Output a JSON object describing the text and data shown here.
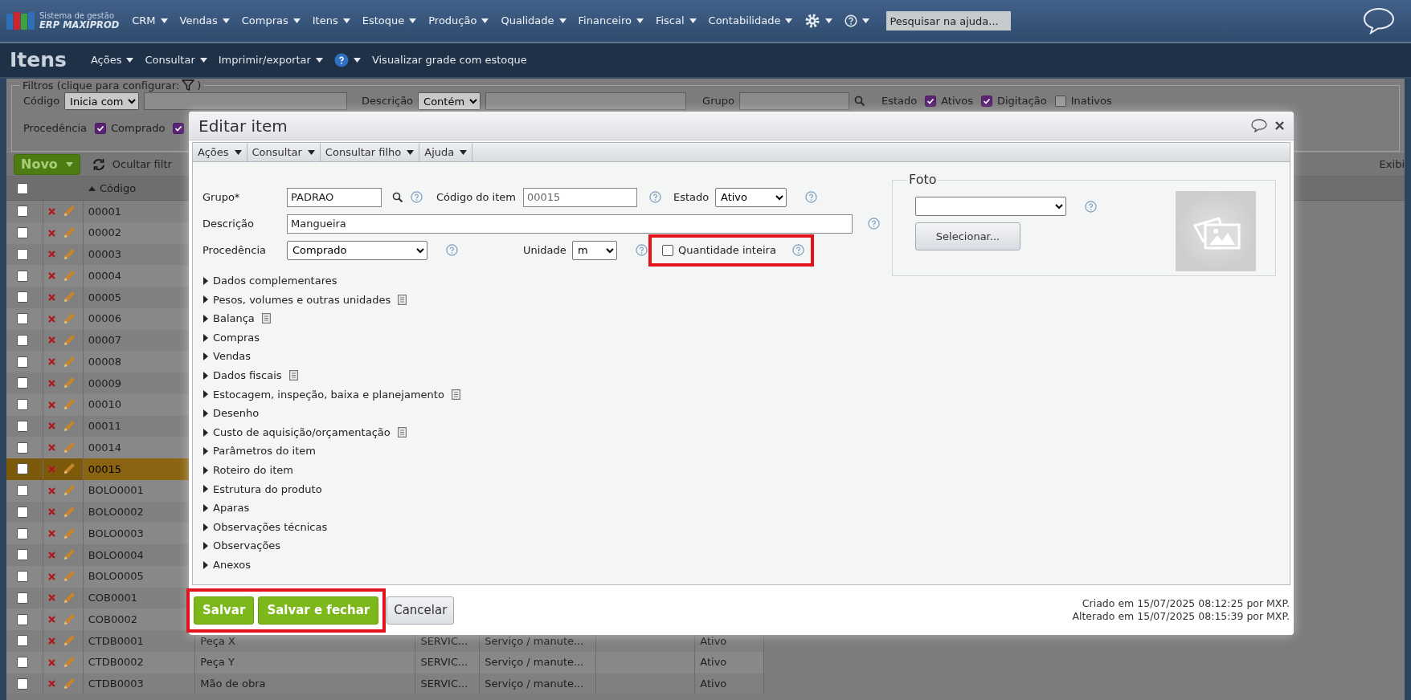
{
  "topbar": {
    "logo": {
      "line_1": "Sistema de gestão",
      "line_2": "ERP MAXIPROD"
    },
    "menu": [
      "CRM",
      "Vendas",
      "Compras",
      "Itens",
      "Estoque",
      "Produção",
      "Qualidade",
      "Financeiro",
      "Fiscal",
      "Contabilidade"
    ],
    "search": {
      "placeholder": "Pesquisar na ajuda..."
    }
  },
  "page": {
    "title": "Itens",
    "menu": [
      {
        "kind": "menu",
        "label": "Ações"
      },
      {
        "kind": "menu",
        "label": "Consultar"
      },
      {
        "kind": "menu",
        "label": "Imprimir/exportar"
      },
      {
        "kind": "help"
      },
      {
        "kind": "link",
        "label": "Visualizar grade com estoque"
      }
    ]
  },
  "filters": {
    "legend_start": "Filtros (clique para configurar:",
    "legend_end": ")",
    "rows": [
      [
        {
          "kind": "text",
          "label": "Código",
          "mode": "Inicia com"
        },
        {
          "kind": "text",
          "label": "Descrição",
          "mode": "Contém"
        },
        {
          "kind": "lookup",
          "label": "Grupo"
        },
        {
          "kind": "checks",
          "label": "Estado",
          "options": [
            {
              "label": "Ativos",
              "checked": true
            },
            {
              "label": "Digitação",
              "checked": true
            },
            {
              "label": "Inativos",
              "checked": false
            }
          ]
        }
      ],
      [
        {
          "kind": "checks",
          "label": "Procedência",
          "options": [
            {
              "label": "Comprado",
              "checked": true
            },
            {
              "checked": true
            }
          ]
        }
      ]
    ]
  },
  "toolbar": {
    "new_button": "Novo",
    "hide_filters": "Ocultar filtr",
    "right_link": "Exibi"
  },
  "table": {
    "header_checkbox": {
      "checked": false
    },
    "columns": [
      {
        "label": "Código",
        "sort_ascending": true
      }
    ],
    "rows": [
      {
        "code": "00001",
        "checked": false,
        "selected": false
      },
      {
        "code": "00002",
        "checked": false,
        "selected": false
      },
      {
        "code": "00003",
        "checked": false,
        "selected": false
      },
      {
        "code": "00004",
        "checked": false,
        "selected": false
      },
      {
        "code": "00005",
        "checked": false,
        "selected": false
      },
      {
        "code": "00006",
        "checked": false,
        "selected": false
      },
      {
        "code": "00007",
        "checked": false,
        "selected": false
      },
      {
        "code": "00008",
        "checked": false,
        "selected": false
      },
      {
        "code": "00009",
        "checked": false,
        "selected": false
      },
      {
        "code": "00010",
        "checked": false,
        "selected": false
      },
      {
        "code": "00011",
        "checked": false,
        "selected": false
      },
      {
        "code": "00014",
        "checked": false,
        "selected": false
      },
      {
        "code": "00015",
        "checked": false,
        "selected": true
      },
      {
        "code": "BOLO0001",
        "checked": false,
        "selected": false
      },
      {
        "code": "BOLO0002",
        "checked": false,
        "selected": false
      },
      {
        "code": "BOLO0003",
        "checked": false,
        "selected": false
      },
      {
        "code": "BOLO0004",
        "checked": false,
        "selected": false
      },
      {
        "code": "BOLO0005",
        "checked": false,
        "selected": false
      },
      {
        "code": "COB0001",
        "checked": false,
        "selected": false
      },
      {
        "code": "COB0002",
        "checked": false,
        "selected": false
      },
      {
        "code": "CTDB0001",
        "checked": false,
        "selected": false,
        "column_4": "Peça X",
        "column_5": "SERVIC...",
        "column_6": "Serviço / manute...",
        "column_8": "Ativo"
      },
      {
        "code": "CTDB0002",
        "checked": false,
        "selected": false,
        "column_4": "Peça Y",
        "column_5": "SERVIC...",
        "column_6": "Serviço / manute...",
        "column_8": "Ativo"
      },
      {
        "code": "CTDB0003",
        "checked": false,
        "selected": false,
        "column_4": "Mão de obra",
        "column_5": "SERVIC...",
        "column_6": "Serviço / manute...",
        "column_8": "Ativo"
      }
    ]
  },
  "modal": {
    "title": "Editar item",
    "menu": [
      "Ações",
      "Consultar",
      "Consultar filho",
      "Ajuda"
    ],
    "group": {
      "label": "Grupo*",
      "value": "PADRAO"
    },
    "code": {
      "label": "Código do item",
      "value": "00015",
      "readonly": true
    },
    "status": {
      "label": "Estado",
      "value": "Ativo"
    },
    "description": {
      "label": "Descrição",
      "value": "Mangueira"
    },
    "origin": {
      "label": "Procedência",
      "value": "Comprado"
    },
    "unit": {
      "label": "Unidade",
      "value": "m"
    },
    "integer_quantity": {
      "label": "Quantidade inteira",
      "checked": false,
      "highlighted": true
    },
    "sections": [
      {
        "label": "Dados complementares",
        "notes": false
      },
      {
        "label": "Pesos, volumes e outras unidades",
        "notes": true
      },
      {
        "label": "Balança",
        "notes": true
      },
      {
        "label": "Compras",
        "notes": false
      },
      {
        "label": "Vendas",
        "notes": false
      },
      {
        "label": "Dados fiscais",
        "notes": true
      },
      {
        "label": "Estocagem, inspeção, baixa e planejamento",
        "notes": true
      },
      {
        "label": "Desenho",
        "notes": false
      },
      {
        "label": "Custo de aquisição/orçamentação",
        "notes": true
      },
      {
        "label": "Parâmetros do item",
        "notes": false
      },
      {
        "label": "Roteiro do item",
        "notes": false
      },
      {
        "label": "Estrutura do produto",
        "notes": false
      },
      {
        "label": "Aparas",
        "notes": false
      },
      {
        "label": "Observações técnicas",
        "notes": false
      },
      {
        "label": "Observações",
        "notes": false
      },
      {
        "label": "Anexos",
        "notes": false
      }
    ],
    "photo": {
      "legend": "Foto",
      "button": "Selecionar..."
    },
    "buttons": [
      {
        "label": "Salvar",
        "kind": "primary"
      },
      {
        "label": "Salvar e fechar",
        "kind": "primary"
      },
      {
        "label": "Cancelar",
        "kind": "secondary"
      }
    ],
    "buttons_highlighted": true,
    "audit": [
      "Criado em 15/07/2025 08:12:25 por MXP.",
      "Alterado em 15/07/2025 08:15:39 por MXP."
    ]
  }
}
